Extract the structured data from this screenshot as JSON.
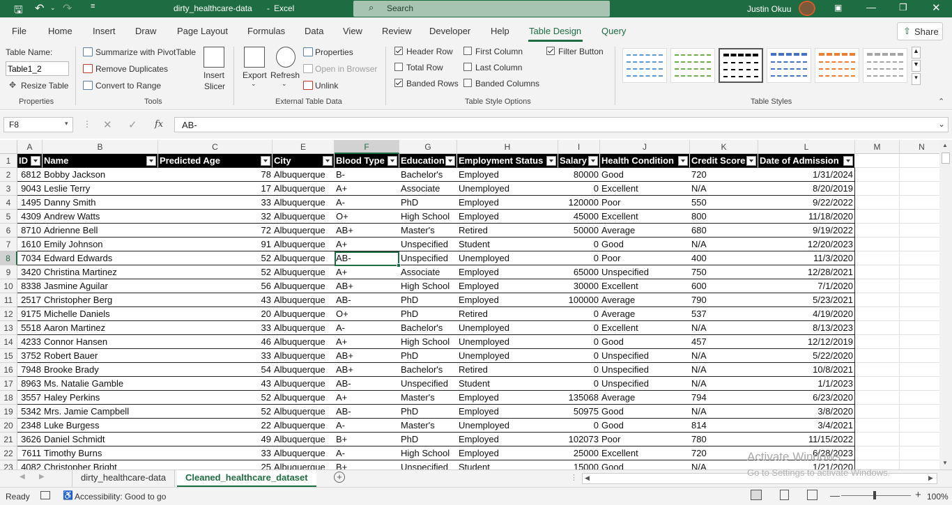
{
  "titlebar": {
    "filename": "dirty_healthcare-data",
    "sep": "-",
    "app": "Excel",
    "search_placeholder": "Search",
    "user": "Justin Okuu"
  },
  "ribbon_tabs": [
    "File",
    "Home",
    "Insert",
    "Draw",
    "Page Layout",
    "Formulas",
    "Data",
    "View",
    "Review",
    "Developer",
    "Help",
    "Table Design",
    "Query"
  ],
  "share_label": "Share",
  "properties": {
    "table_name_label": "Table Name:",
    "table_name_value": "Table1_2",
    "resize": "Resize Table",
    "group": "Properties"
  },
  "tools": {
    "pivot": "Summarize with PivotTable",
    "dupes": "Remove Duplicates",
    "convert": "Convert to Range",
    "insert_slicer_1": "Insert",
    "insert_slicer_2": "Slicer",
    "group": "Tools"
  },
  "external": {
    "export": "Export",
    "refresh": "Refresh",
    "properties": "Properties",
    "open_browser": "Open in Browser",
    "unlink": "Unlink",
    "group": "External Table Data"
  },
  "style_options": {
    "header_row": "Header Row",
    "total_row": "Total Row",
    "banded_rows": "Banded Rows",
    "first_column": "First Column",
    "last_column": "Last Column",
    "banded_columns": "Banded Columns",
    "filter_button": "Filter Button",
    "group": "Table Style Options"
  },
  "table_styles_group": "Table Styles",
  "style_colors": [
    "#5b9bd5",
    "#70ad47",
    "#000000",
    "#4472c4",
    "#ed7d31",
    "#a5a5a5"
  ],
  "formula_bar": {
    "name_box": "F8",
    "fx": "fx",
    "content": "AB-"
  },
  "columns": [
    "A",
    "B",
    "C",
    "E",
    "F",
    "G",
    "H",
    "I",
    "J",
    "K",
    "L",
    "M",
    "N"
  ],
  "row_numbers": [
    "1",
    "2",
    "3",
    "4",
    "5",
    "6",
    "7",
    "8",
    "9",
    "10",
    "11",
    "12",
    "13",
    "14",
    "15",
    "16",
    "17",
    "18",
    "19",
    "20",
    "21",
    "22",
    "23"
  ],
  "table": {
    "headers": [
      "ID",
      "Name",
      "Predicted Age",
      "City",
      "Blood Type",
      "Education",
      "Employment Status",
      "Salary",
      "Health Condition",
      "Credit Score",
      "Date of Admission"
    ],
    "rows": [
      [
        "6812",
        "Bobby Jackson",
        "78",
        "Albuquerque",
        "B-",
        "Bachelor's",
        "Employed",
        "80000",
        "Good",
        "720",
        "1/31/2024"
      ],
      [
        "9043",
        "Leslie Terry",
        "17",
        "Albuquerque",
        "A+",
        "Associate",
        "Unemployed",
        "0",
        "Excellent",
        "N/A",
        "8/20/2019"
      ],
      [
        "1495",
        "Danny Smith",
        "33",
        "Albuquerque",
        "A-",
        "PhD",
        "Employed",
        "120000",
        "Poor",
        "550",
        "9/22/2022"
      ],
      [
        "4309",
        "Andrew Watts",
        "32",
        "Albuquerque",
        "O+",
        "High School",
        "Employed",
        "45000",
        "Excellent",
        "800",
        "11/18/2020"
      ],
      [
        "8710",
        "Adrienne Bell",
        "72",
        "Albuquerque",
        "AB+",
        "Master's",
        "Retired",
        "50000",
        "Average",
        "680",
        "9/19/2022"
      ],
      [
        "1610",
        "Emily Johnson",
        "91",
        "Albuquerque",
        "A+",
        "Unspecified",
        "Student",
        "0",
        "Good",
        "N/A",
        "12/20/2023"
      ],
      [
        "7034",
        "Edward Edwards",
        "52",
        "Albuquerque",
        "AB-",
        "Unspecified",
        "Unemployed",
        "0",
        "Poor",
        "400",
        "11/3/2020"
      ],
      [
        "3420",
        "Christina Martinez",
        "52",
        "Albuquerque",
        "A+",
        "Associate",
        "Employed",
        "65000",
        "Unspecified",
        "750",
        "12/28/2021"
      ],
      [
        "8338",
        "Jasmine Aguilar",
        "56",
        "Albuquerque",
        "AB+",
        "High School",
        "Employed",
        "30000",
        "Excellent",
        "600",
        "7/1/2020"
      ],
      [
        "2517",
        "Christopher Berg",
        "43",
        "Albuquerque",
        "AB-",
        "PhD",
        "Employed",
        "100000",
        "Average",
        "790",
        "5/23/2021"
      ],
      [
        "9175",
        "Michelle Daniels",
        "20",
        "Albuquerque",
        "O+",
        "PhD",
        "Retired",
        "0",
        "Average",
        "537",
        "4/19/2020"
      ],
      [
        "5518",
        "Aaron Martinez",
        "33",
        "Albuquerque",
        "A-",
        "Bachelor's",
        "Unemployed",
        "0",
        "Excellent",
        "N/A",
        "8/13/2023"
      ],
      [
        "4233",
        "Connor Hansen",
        "46",
        "Albuquerque",
        "A+",
        "High School",
        "Unemployed",
        "0",
        "Good",
        "457",
        "12/12/2019"
      ],
      [
        "3752",
        "Robert Bauer",
        "33",
        "Albuquerque",
        "AB+",
        "PhD",
        "Unemployed",
        "0",
        "Unspecified",
        "N/A",
        "5/22/2020"
      ],
      [
        "7948",
        "Brooke Brady",
        "54",
        "Albuquerque",
        "AB+",
        "Bachelor's",
        "Retired",
        "0",
        "Unspecified",
        "N/A",
        "10/8/2021"
      ],
      [
        "8963",
        "Ms. Natalie Gamble",
        "43",
        "Albuquerque",
        "AB-",
        "Unspecified",
        "Student",
        "0",
        "Unspecified",
        "N/A",
        "1/1/2023"
      ],
      [
        "3557",
        "Haley Perkins",
        "52",
        "Albuquerque",
        "A+",
        "Master's",
        "Employed",
        "135068",
        "Average",
        "794",
        "6/23/2020"
      ],
      [
        "5342",
        "Mrs. Jamie Campbell",
        "52",
        "Albuquerque",
        "AB-",
        "PhD",
        "Employed",
        "50975",
        "Good",
        "N/A",
        "3/8/2020"
      ],
      [
        "2348",
        "Luke Burgess",
        "22",
        "Albuquerque",
        "A-",
        "Master's",
        "Unemployed",
        "0",
        "Good",
        "814",
        "3/4/2021"
      ],
      [
        "3626",
        "Daniel Schmidt",
        "49",
        "Albuquerque",
        "B+",
        "PhD",
        "Employed",
        "102073",
        "Poor",
        "780",
        "11/15/2022"
      ],
      [
        "7611",
        "Timothy Burns",
        "33",
        "Albuquerque",
        "A-",
        "High School",
        "Employed",
        "25000",
        "Excellent",
        "720",
        "6/28/2023"
      ],
      [
        "4082",
        "Christopher Bright",
        "25",
        "Albuquerque",
        "B+",
        "Unspecified",
        "Student",
        "15000",
        "Good",
        "N/A",
        "1/21/2020"
      ]
    ]
  },
  "sheet_tabs": [
    "dirty_healthcare-data",
    "Cleaned_healthcare_dataset"
  ],
  "status": {
    "ready": "Ready",
    "accessibility": "Accessibility: Good to go",
    "zoom": "100%"
  },
  "watermark": {
    "line1": "Activate Windows",
    "line2": "Go to Settings to activate Windows."
  }
}
